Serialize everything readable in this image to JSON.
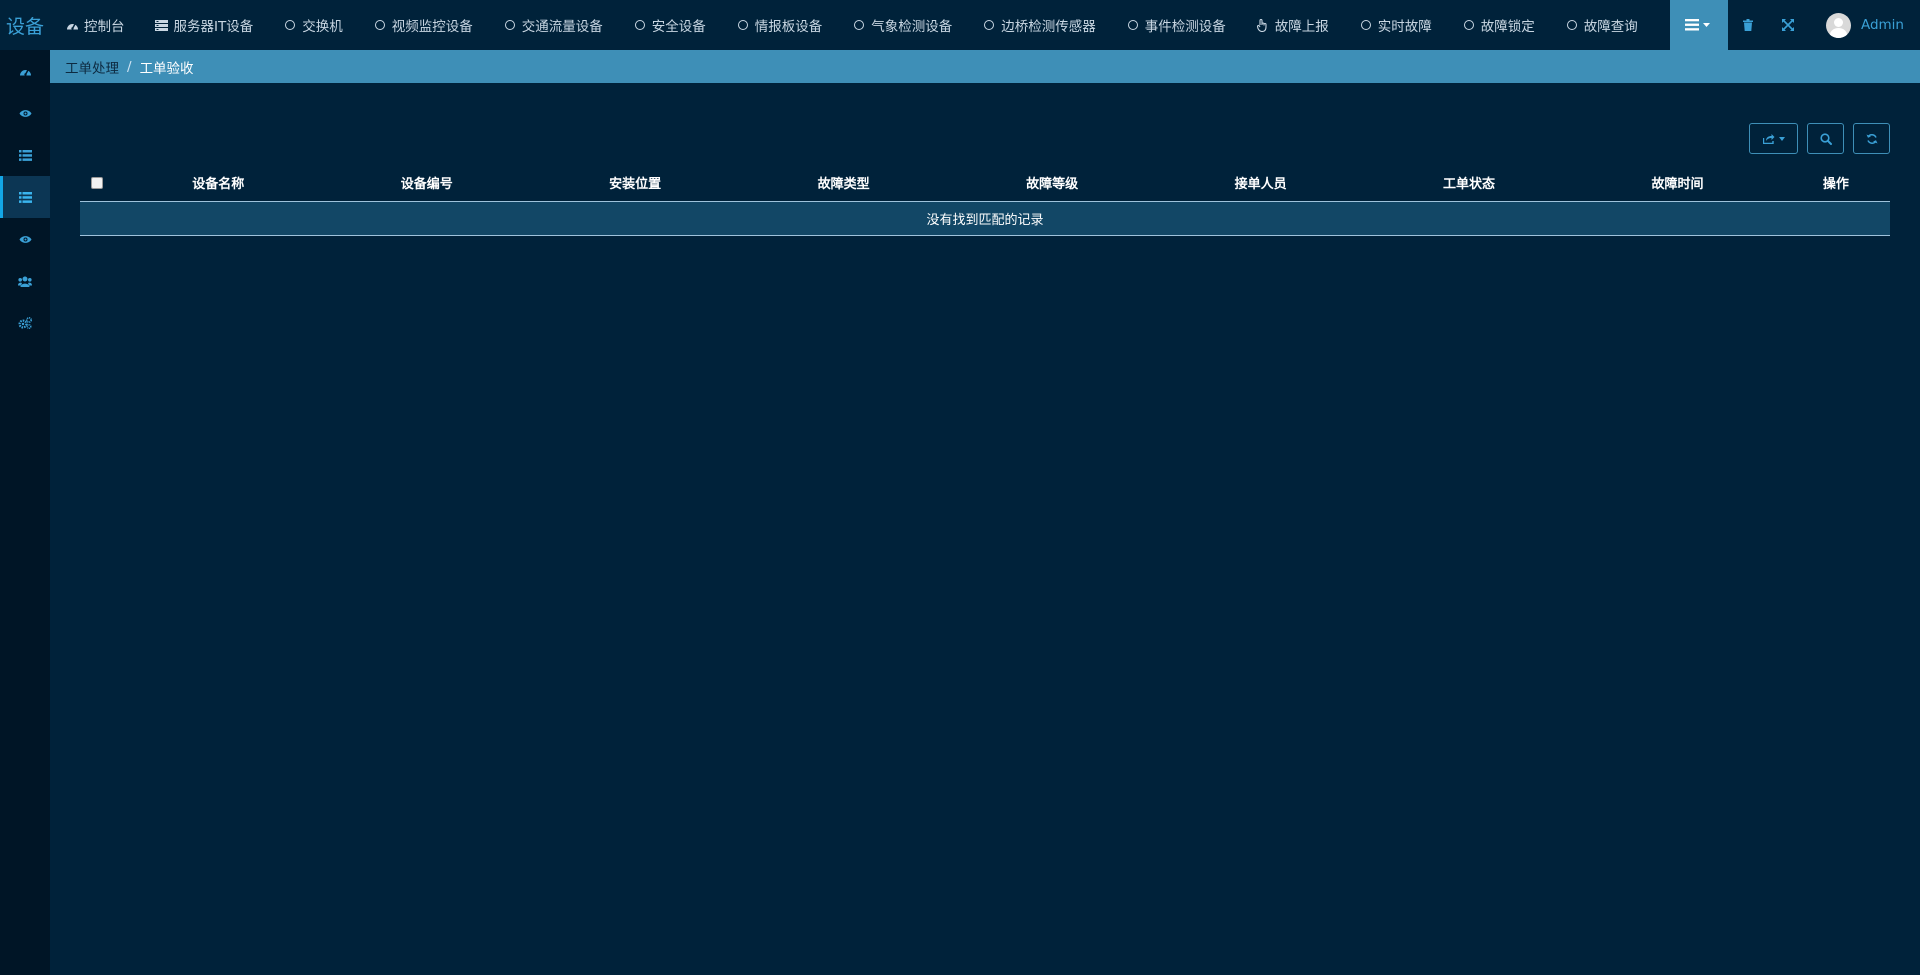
{
  "brand": {
    "text": "设备"
  },
  "nav": [
    {
      "label": "控制台",
      "icon": "dashboard-icon"
    },
    {
      "label": "服务器IT设备",
      "icon": "server-icon"
    },
    {
      "label": "交换机",
      "icon": "circle-icon"
    },
    {
      "label": "视频监控设备",
      "icon": "circle-icon"
    },
    {
      "label": "交通流量设备",
      "icon": "circle-icon"
    },
    {
      "label": "安全设备",
      "icon": "circle-icon"
    },
    {
      "label": "情报板设备",
      "icon": "circle-icon"
    },
    {
      "label": "气象检测设备",
      "icon": "circle-icon"
    },
    {
      "label": "边桥检测传感器",
      "icon": "circle-icon"
    },
    {
      "label": "事件检测设备",
      "icon": "circle-icon"
    },
    {
      "label": "故障上报",
      "icon": "hand-pointer-icon"
    },
    {
      "label": "实时故障",
      "icon": "circle-icon"
    },
    {
      "label": "故障锁定",
      "icon": "circle-icon"
    },
    {
      "label": "故障查询",
      "icon": "circle-icon"
    }
  ],
  "user": {
    "name": "Admin"
  },
  "sidebar": [
    {
      "icon": "dashboard-icon"
    },
    {
      "icon": "eye-icon"
    },
    {
      "icon": "list-icon"
    },
    {
      "icon": "list-icon",
      "active": true
    },
    {
      "icon": "eye-icon"
    },
    {
      "icon": "users-icon"
    },
    {
      "icon": "cogs-icon"
    }
  ],
  "breadcrumb": {
    "parent": "工单处理",
    "separator": "/",
    "current": "工单验收"
  },
  "table": {
    "columns": [
      "设备名称",
      "设备编号",
      "安装位置",
      "故障类型",
      "故障等级",
      "接单人员",
      "工单状态",
      "故障时间",
      "操作"
    ],
    "empty_text": "没有找到匹配的记录"
  },
  "colors": {
    "background": "#00223a",
    "sidebar": "#001526",
    "accent": "#3e8fb7",
    "link": "#3aa0d6",
    "empty_row": "#124766"
  }
}
